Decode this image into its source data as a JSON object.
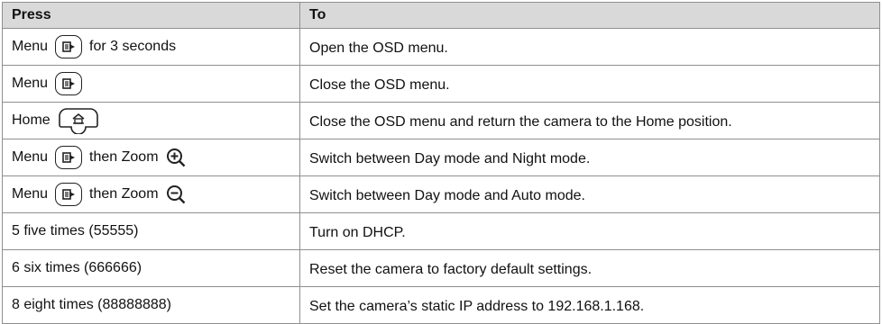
{
  "table": {
    "headers": {
      "press": "Press",
      "to": "To"
    },
    "rows": [
      {
        "press": {
          "label": "Menu",
          "suffix": "for 3 seconds"
        },
        "to": "Open the OSD menu."
      },
      {
        "press": {
          "label": "Menu"
        },
        "to": "Close the OSD menu."
      },
      {
        "press": {
          "label": "Home"
        },
        "to": "Close the OSD menu and return the camera to the Home position."
      },
      {
        "press": {
          "label": "Menu",
          "middle": "then Zoom"
        },
        "to": "Switch between Day mode and Night mode."
      },
      {
        "press": {
          "label": "Menu",
          "middle": "then Zoom"
        },
        "to": "Switch between Day mode and Auto mode."
      },
      {
        "press": {
          "label": "5 five times (55555)"
        },
        "to": "Turn on DHCP."
      },
      {
        "press": {
          "label": "6 six times (666666)"
        },
        "to": "Reset the camera to factory default settings."
      },
      {
        "press": {
          "label": "8 eight times (88888888)"
        },
        "to": "Set the camera’s static IP address to 192.168.1.168."
      }
    ]
  },
  "icons": {
    "menu_key": "menu-key-icon",
    "home_key": "home-key-icon",
    "zoom_in": "zoom-in-icon",
    "zoom_out": "zoom-out-icon"
  },
  "colors": {
    "header_bg": "#d9d9d9",
    "border": "#8f8f8f",
    "text": "#111111"
  }
}
